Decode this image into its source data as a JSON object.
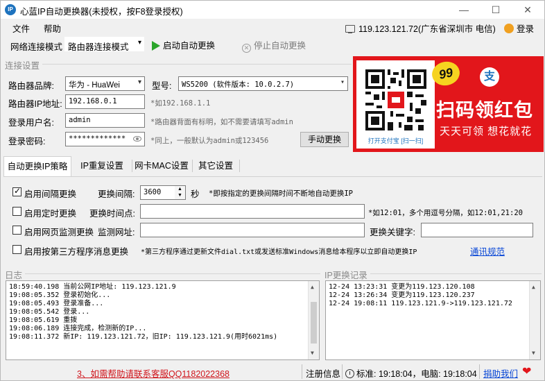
{
  "window": {
    "title": "心蓝IP自动更换器(未授权，按F8登录授权)",
    "icon_text": "IP",
    "minimize": "—",
    "maximize": "☐",
    "close": "✕"
  },
  "menu": {
    "file": "文件",
    "help": "帮助",
    "ip_info": "119.123.121.72(广东省深圳市 电信)",
    "login": "登录"
  },
  "toolbar": {
    "mode_label": "网络连接模式",
    "mode_value": "路由器连接模式",
    "start": "启动自动更换",
    "stop": "停止自动更换"
  },
  "connection": {
    "group_title": "连接设置",
    "brand_label": "路由器品牌:",
    "brand_value": "华为 - HuaWei",
    "model_label": "型号:",
    "model_value": "WS5200 (软件版本: 10.0.2.7)",
    "ip_label": "路由器IP地址:",
    "ip_value": "192.168.0.1",
    "ip_hint": "*如192.168.1.1",
    "user_label": "登录用户名:",
    "user_value": "admin",
    "user_hint": "*路由器背面有标明，如不需要请填写admin",
    "pwd_label": "登录密码:",
    "pwd_value": "*************",
    "pwd_hint": "*同上，一般默认为admin或123456",
    "manual_button": "手动更换"
  },
  "ad": {
    "badge": "99",
    "alipay_glyph": "支",
    "title": "扫码领红包",
    "subtitle": "天天可领 想花就花",
    "qr_caption": "打开支付宝 [扫一扫]"
  },
  "tabs": [
    {
      "label": "自动更换IP策略",
      "active": true
    },
    {
      "label": "IP重复设置",
      "active": false
    },
    {
      "label": "网卡MAC设置",
      "active": false
    },
    {
      "label": "其它设置",
      "active": false
    }
  ],
  "strategy": {
    "interval": {
      "checked": true,
      "label": "启用间隔更换",
      "field_label": "更换间隔:",
      "value": "3600",
      "unit": "秒",
      "hint": "*即按指定的更换间隔时间不断地自动更换IP"
    },
    "timed": {
      "checked": false,
      "label": "启用定时更换",
      "field_label": "更换时间点:",
      "value": "",
      "hint": "*如12:01，多个用逗号分隔，如12:01,21:20"
    },
    "web_monitor": {
      "checked": false,
      "label": "启用网页监测更换",
      "field_label": "监测网址:",
      "value": "",
      "keyword_label": "更换关键字:",
      "keyword_value": ""
    },
    "third_party": {
      "checked": false,
      "label": "启用按第三方程序消息更换",
      "hint": "*第三方程序通过更新文件dial.txt或发送标准Windows消息给本程序以立即自动更换IP",
      "link": "通讯规范"
    }
  },
  "log": {
    "title": "日志",
    "lines": [
      "18:59:40.198 当前公网IP地址: 119.123.121.9",
      "19:08:05.352 登录初始化...",
      "19:08:05.493 登录准备...",
      "19:08:05.542 登录...",
      "19:08:05.619 重拨",
      "19:08:06.189 连接完成，检测新的IP...",
      "19:08:11.372 新IP: 119.123.121.72，旧IP: 119.123.121.9(用时6021ms)"
    ]
  },
  "ip_history": {
    "title": "IP更换记录",
    "lines": [
      "12-24 13:23:31 变更为119.123.120.108",
      "12-24 13:26:34 变更为119.123.120.237",
      "12-24 19:08:11  119.123.121.9->119.123.121.72"
    ]
  },
  "status": {
    "help": "3、如需帮助请联系客服QQ1182022368",
    "register": "注册信息",
    "time": "标准: 19:18:04，电脑: 19:18:04",
    "donate": "捐助我们"
  },
  "colors": {
    "accent_red": "#e2161b",
    "link_blue": "#0645d6",
    "play_green": "#2aa52a"
  }
}
